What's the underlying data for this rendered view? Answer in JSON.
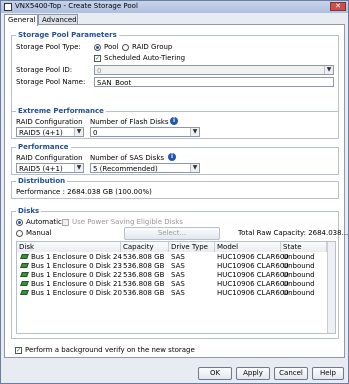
{
  "window": {
    "title": "VNX5400-Top - Create Storage Pool",
    "close_glyph": "✕"
  },
  "tabs": [
    {
      "label": "General"
    },
    {
      "label": "Advanced"
    }
  ],
  "params": {
    "group_title": "Storage Pool Parameters",
    "type_label": "Storage Pool Type:",
    "pool_label": "Pool",
    "raid_label": "RAID Group",
    "auto_tiering_label": "Scheduled Auto-Tiering",
    "id_label": "Storage Pool ID:",
    "id_value": "0",
    "name_label": "Storage Pool Name:",
    "name_value": "SAN_Boot"
  },
  "extreme": {
    "group_title": "Extreme Performance",
    "raid_label": "RAID Configuration",
    "raid_value": "RAID5 (4+1)",
    "disks_label": "Number of Flash Disks",
    "disks_value": "0"
  },
  "performance": {
    "group_title": "Performance",
    "raid_label": "RAID Configuration",
    "raid_value": "RAID5 (4+1)",
    "disks_label": "Number of SAS Disks",
    "disks_value": "5 (Recommended)"
  },
  "distribution": {
    "group_title": "Distribution",
    "text": "Performance : 2684.038 GB (100.00%)"
  },
  "disks": {
    "group_title": "Disks",
    "automatic_label": "Automatic",
    "power_saving_label": "Use Power Saving Eligible Disks",
    "manual_label": "Manual",
    "select_label": "Select...",
    "total_raw": "Total Raw Capacity: 2684.038...",
    "columns": [
      "Disk",
      "Capacity",
      "Drive Type",
      "Model",
      "State"
    ],
    "rows": [
      {
        "disk": "Bus 1 Enclosure 0 Disk 24",
        "capacity": "536.808 GB",
        "type": "SAS",
        "model": "HUC10906 CLAR600",
        "state": "Unbound"
      },
      {
        "disk": "Bus 1 Enclosure 0 Disk 23",
        "capacity": "536.808 GB",
        "type": "SAS",
        "model": "HUC10906 CLAR600",
        "state": "Unbound"
      },
      {
        "disk": "Bus 1 Enclosure 0 Disk 22",
        "capacity": "536.808 GB",
        "type": "SAS",
        "model": "HUC10906 CLAR600",
        "state": "Unbound"
      },
      {
        "disk": "Bus 1 Enclosure 0 Disk 21",
        "capacity": "536.808 GB",
        "type": "SAS",
        "model": "HUC10906 CLAR600",
        "state": "Unbound"
      },
      {
        "disk": "Bus 1 Enclosure 0 Disk 20",
        "capacity": "536.808 GB",
        "type": "SAS",
        "model": "HUC10906 CLAR600",
        "state": "Unbound"
      }
    ]
  },
  "verify_label": "Perform a background verify on the new storage",
  "buttons": {
    "ok": "OK",
    "apply": "Apply",
    "cancel": "Cancel",
    "help": "Help"
  },
  "colors": {
    "group_title": "#1f4e9c",
    "disk_icon": "#3c8d3c"
  }
}
